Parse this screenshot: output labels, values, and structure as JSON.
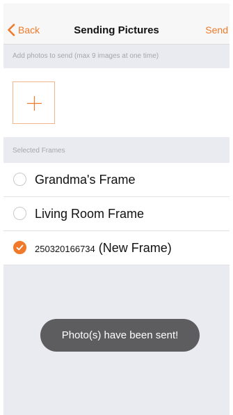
{
  "navbar": {
    "back_label": "Back",
    "title": "Sending Pictures",
    "send_label": "Send"
  },
  "photos": {
    "hint": "Add photos to send (max 9 images at one time)"
  },
  "frames": {
    "section_label": "Selected Frames",
    "items": [
      {
        "name": "Grandma's Frame",
        "selected": false
      },
      {
        "name": "Living Room Frame",
        "selected": false
      },
      {
        "name_number": "250320166734",
        "name_suffix": "(New Frame)",
        "selected": true
      }
    ]
  },
  "toast": {
    "message": "Photo(s) have been sent!"
  },
  "colors": {
    "accent": "#f07a2a",
    "toast_bg": "#5d5d5f",
    "background": "#eaebf0"
  },
  "icons": {
    "back": "chevron-left-icon",
    "add": "plus-icon",
    "check": "checkmark-icon"
  }
}
